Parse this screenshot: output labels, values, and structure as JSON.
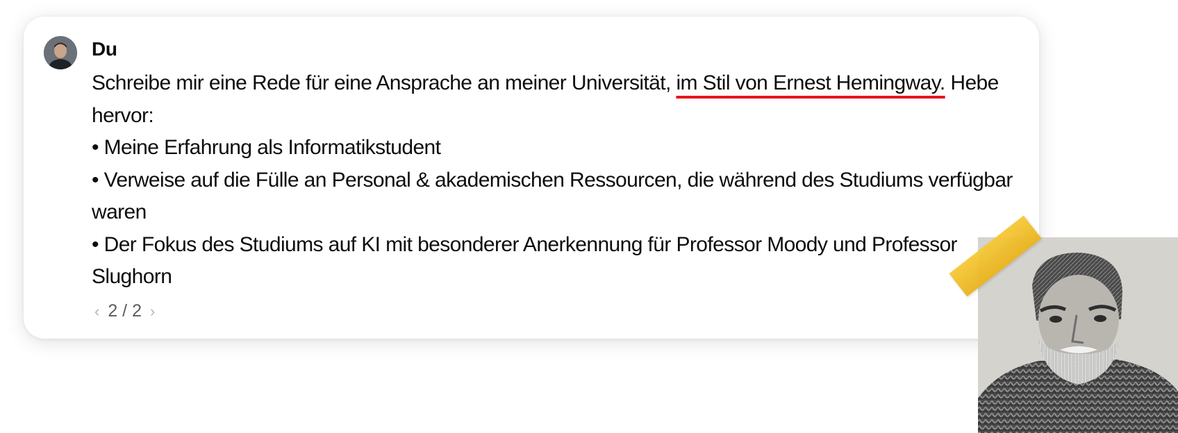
{
  "message": {
    "author": "Du",
    "intro_before": "Schreibe mir eine Rede für eine Ansprache an meiner Universität,",
    "intro_highlight": "im Stil von Ernest Hemingway.",
    "intro_after": "Hebe hervor:",
    "bullets": [
      "• Meine Erfahrung als Informatikstudent",
      "• Verweise auf die Fülle an Personal & akademischen Ressourcen, die während des Studiums verfügbar waren",
      "• Der Fokus des Studiums auf KI mit besonderer Anerkennung für Professor Moody und Professor Slughorn"
    ]
  },
  "pagination": {
    "prev_icon": "chevron-left-icon",
    "label": "2 / 2",
    "next_icon": "chevron-right-icon"
  },
  "colors": {
    "highlight_underline": "#e8141b",
    "tape": "#f0c12c"
  }
}
